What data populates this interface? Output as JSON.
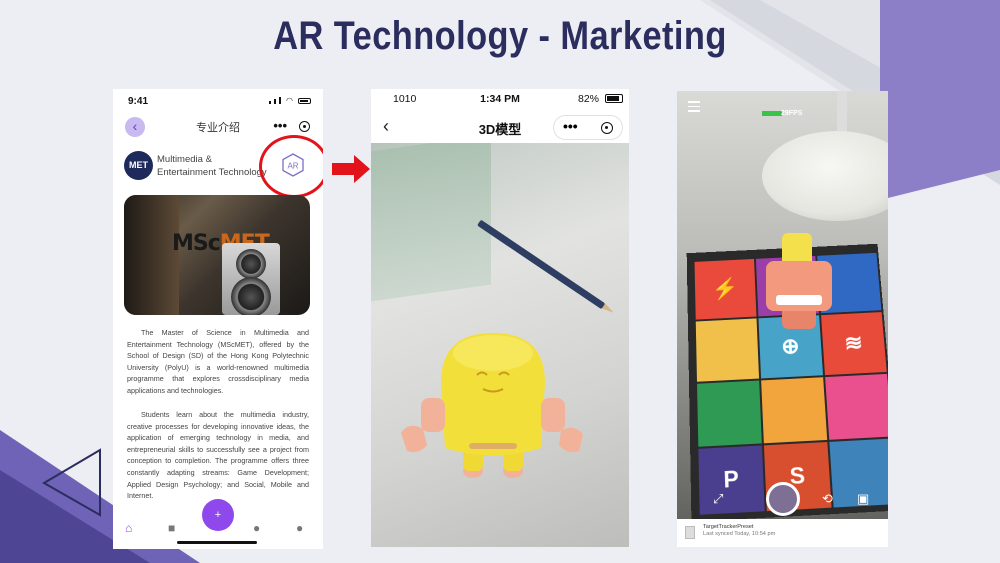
{
  "slide": {
    "title": "AR Technology - Marketing",
    "colors": {
      "title": "#2b2d5e",
      "accent": "#7b6fc4",
      "highlight": "#e3131c"
    }
  },
  "phone1": {
    "status_time": "9:41",
    "nav_title": "专业介绍",
    "nav_more": "•••",
    "programme_logo": "MET",
    "programme_name_line1": "Multimedia &",
    "programme_name_line2": "Entertainment Technology",
    "ar_badge": "AR",
    "photo_sign_prefix": "MSc",
    "photo_sign_suffix": "MET",
    "paragraph1": "The Master of Science in Multimedia and Entertainment Technology (MScMET), offered by the School of Design (SD) of the Hong Kong Polytechnic University (PolyU) is a world-renowned multimedia programme that explores crossdisciplinary media applications and technologies.",
    "paragraph2": "Students learn about the multimedia industry, creative processes for developing innovative ideas, the application of emerging technology in media, and entrepreneurial skills to successfully see a project from conception to completion. The programme offers three constantly adapting streams: Game Development; Applied Design Psychology; and Social, Mobile and Internet.",
    "fab_label": "+",
    "tabs": [
      "home-icon",
      "video-icon",
      "add-icon",
      "people-icon",
      "person-icon"
    ]
  },
  "phone2": {
    "carrier": "1010",
    "time": "1:34 PM",
    "battery": "82%",
    "nav_title": "3D模型",
    "nav_more": "•••"
  },
  "phone3": {
    "fps": "29FPS",
    "footer_line1": "TargetTrackerPreset",
    "footer_line2": "Last synced Today, 10:54 pm"
  }
}
